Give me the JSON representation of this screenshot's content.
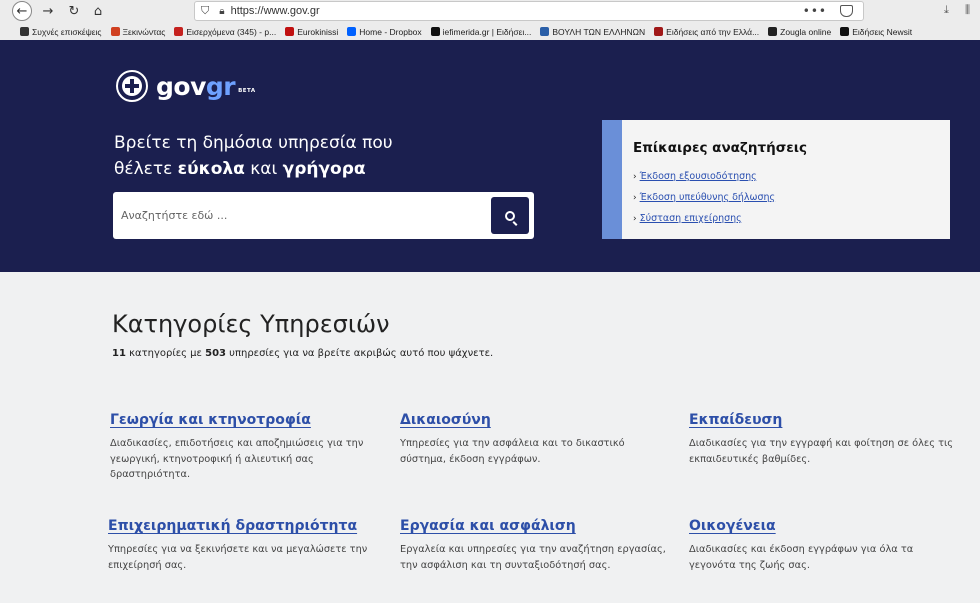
{
  "browser": {
    "url": "https://www.gov.gr",
    "menu_dots": "•••",
    "bookmarks": [
      {
        "label": "Συχνές επισκέψεις",
        "color": "#333333"
      },
      {
        "label": "Ξεκινώντας",
        "color": "#d04020"
      },
      {
        "label": "Εισερχόμενα (345) - p...",
        "color": "#c5221f"
      },
      {
        "label": "Eurokinissi",
        "color": "#c01010"
      },
      {
        "label": "Home - Dropbox",
        "color": "#0061ff"
      },
      {
        "label": "iefimerida.gr | Ειδήσει...",
        "color": "#111111"
      },
      {
        "label": "ΒΟΥΛΗ ΤΩΝ ΕΛΛΗΝΩΝ",
        "color": "#2a5fa8"
      },
      {
        "label": "Ειδήσεις από την Ελλά...",
        "color": "#a01818"
      },
      {
        "label": "Zougla online",
        "color": "#222222"
      },
      {
        "label": "Ειδήσεις Newsit",
        "color": "#111111"
      }
    ]
  },
  "hero": {
    "logo_text_gov": "gov",
    "logo_text_gr": "gr",
    "logo_beta": "BETA",
    "tagline_line1": "Βρείτε τη δημόσια υπηρεσία που",
    "tagline_prefix": "θέλετε ",
    "tagline_bold1": "εύκολα",
    "tagline_mid": " και ",
    "tagline_bold2": "γρήγορα",
    "search_placeholder": "Αναζητήστε εδώ ...",
    "trending_title": "Επίκαιρες αναζητήσεις",
    "trending_links": [
      "Έκδοση εξουσιοδότησης",
      "Έκδοση υπεύθυνης δήλωσης",
      "Σύσταση επιχείρησης"
    ]
  },
  "categories": {
    "heading": "Κατηγορίες Υπηρεσιών",
    "count": "11",
    "subtitle_mid": " κατηγορίες με ",
    "services": "503",
    "subtitle_end": " υπηρεσίες για να βρείτε ακριβώς αυτό που ψάχνετε.",
    "items": [
      {
        "title": "Γεωργία και κτηνοτροφία",
        "desc": "Διαδικασίες, επιδοτήσεις και αποζημιώσεις για την γεωργική, κτηνοτροφική ή αλιευτική σας δραστηριότητα."
      },
      {
        "title": "Δικαιοσύνη",
        "desc": "Υπηρεσίες για την ασφάλεια και το δικαστικό σύστημα, έκδοση εγγράφων."
      },
      {
        "title": "Εκπαίδευση",
        "desc": "Διαδικασίες για την εγγραφή και φοίτηση σε όλες τις εκπαιδευτικές βαθμίδες."
      },
      {
        "title": "Επιχειρηματική δραστηριότητα",
        "desc": "Υπηρεσίες για να ξεκινήσετε και να μεγαλώσετε την επιχείρησή σας."
      },
      {
        "title": "Εργασία και ασφάλιση",
        "desc": "Εργαλεία και υπηρεσίες για την αναζήτηση εργασίας, την ασφάλιση και τη συνταξιοδότησή σας."
      },
      {
        "title": "Οικογένεια",
        "desc": "Διαδικασίες και έκδοση εγγράφων για όλα τα γεγονότα της ζωής σας."
      }
    ]
  }
}
